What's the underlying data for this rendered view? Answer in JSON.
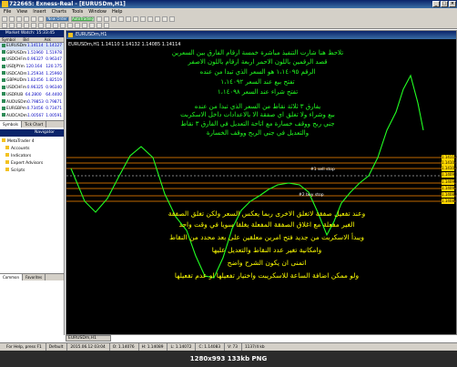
{
  "window": {
    "title": "722665: Exness-Real - [EURUSDm,H1]"
  },
  "menu": [
    "File",
    "View",
    "Insert",
    "Charts",
    "Tools",
    "Window",
    "Help"
  ],
  "toolbar": {
    "new_order": "New Order",
    "autotrading": "AutoTrading"
  },
  "market_watch": {
    "title": "Market Watch: 15:33:45",
    "columns": [
      "Symbol",
      "Bid",
      "Ask"
    ],
    "rows": [
      {
        "symbol": "EURUSDm",
        "bid": "1.14114",
        "ask": "1.14127"
      },
      {
        "symbol": "GBPUSDm",
        "bid": "1.51960",
        "ask": "1.51978"
      },
      {
        "symbol": "USDCHFm",
        "bid": "0.96327",
        "ask": "0.96347"
      },
      {
        "symbol": "USDJPYm",
        "bid": "120.164",
        "ask": "120.175"
      },
      {
        "symbol": "USDCADm",
        "bid": "1.25934",
        "ask": "1.25960"
      },
      {
        "symbol": "GBPAUDm",
        "bid": "1.82456",
        "ask": "1.82519"
      },
      {
        "symbol": "USDCHFm",
        "bid": "0.96325",
        "ask": "0.96340"
      },
      {
        "symbol": "USDRUB",
        "bid": "64.2800",
        "ask": "64.4400"
      },
      {
        "symbol": "AUDUSDm",
        "bid": "0.79853",
        "ask": "0.79871"
      },
      {
        "symbol": "EURGBPm",
        "bid": "0.73456",
        "ask": "0.73471"
      },
      {
        "symbol": "AUDCADm",
        "bid": "1.00567",
        "ask": "1.00591"
      }
    ],
    "tabs": [
      "Symbols",
      "Tick Chart"
    ]
  },
  "navigator": {
    "title": "Navigator",
    "items": [
      {
        "label": "MetaTrader 4",
        "root": true
      },
      {
        "label": "Accounts",
        "root": false
      },
      {
        "label": "Indicators",
        "root": false
      },
      {
        "label": "Expert Advisors",
        "root": false
      },
      {
        "label": "Scripts",
        "root": false
      }
    ],
    "tabs": [
      "Common",
      "Favorites"
    ]
  },
  "chart": {
    "header": "EURUSDm,H1",
    "symbol_line": "EURUSDm,H1 1.14110 1.14132 1.14085 1.14114",
    "green_lines": [
      "تلاحظ هنا شارت التنفيذ مباشرة خمسة ارقام الفارق بين السعرين",
      "قصد الرقمين باللون الاحمر اربعة ارقام باللون الاصفر",
      "الرقم ١،١٤٠٩٥ هو السعر الذي تبدا من عنده",
      "تفتح بيع عند السعر ١،١٤٠٩٢",
      "تفتح شراء عند السعر ١،١٤٠٩٨",
      "يفارق ٣ ثلاثة نقاط من السعر الذي تبدا من عنده",
      "بيع وشراء ولا تغلق اي صفقة الا بالاعدادات داخل الاسكربت",
      "جني ربح ووقف خسارة مع اتاحة التعديل في الفارق ٣ نقاط",
      "والتعديل في جني الربح ووقف الخسارة"
    ],
    "yellow_lines": [
      "وعند تفعيل صفقة لاتغلق الاخرى ربما يعكس السعر ولكن تغلق الصفقة",
      "الغير مفعلة مع اغلاق الصفقة المفعلة يغلقا سويا في وقت واحد",
      "ويبدأ الاسكربت من جديد فتح امرين معلقين على بعد محدد من النقاط",
      "وامكانية تغير عدد النقاط والتعديل عليها",
      "اتمنى ان يكون الشرح واضح",
      "ولو ممكن اضافة الساعة للاسكريبت واختيار تفعيلها او عدم تفعيلها"
    ],
    "level_labels": [
      "1.14110",
      "1.14104",
      "1.14100",
      "1.14098",
      "1.14095",
      "1.14092",
      "1.14089",
      "1.14085"
    ],
    "order_labels": [
      "#1 sell stop",
      "#2 buy stop"
    ],
    "colors": {
      "price_line": "#22ff22",
      "level_line": "#ff8c00",
      "level_tag": "#ffd700",
      "text_green": "#22ff22",
      "text_yellow": "#ffff00"
    }
  },
  "chart_tab": "EURUSDm,H1",
  "status": {
    "help": "For Help, press F1",
    "profile": "Default",
    "datetime": "2015.06.12 03:04",
    "open": "O: 1.14076",
    "high": "H: 1.14089",
    "low": "L: 1.14072",
    "close": "C: 1.14083",
    "volume": "V: 73",
    "traffic": "1137/4 kb"
  },
  "footer": "1280x993 133kb PNG"
}
